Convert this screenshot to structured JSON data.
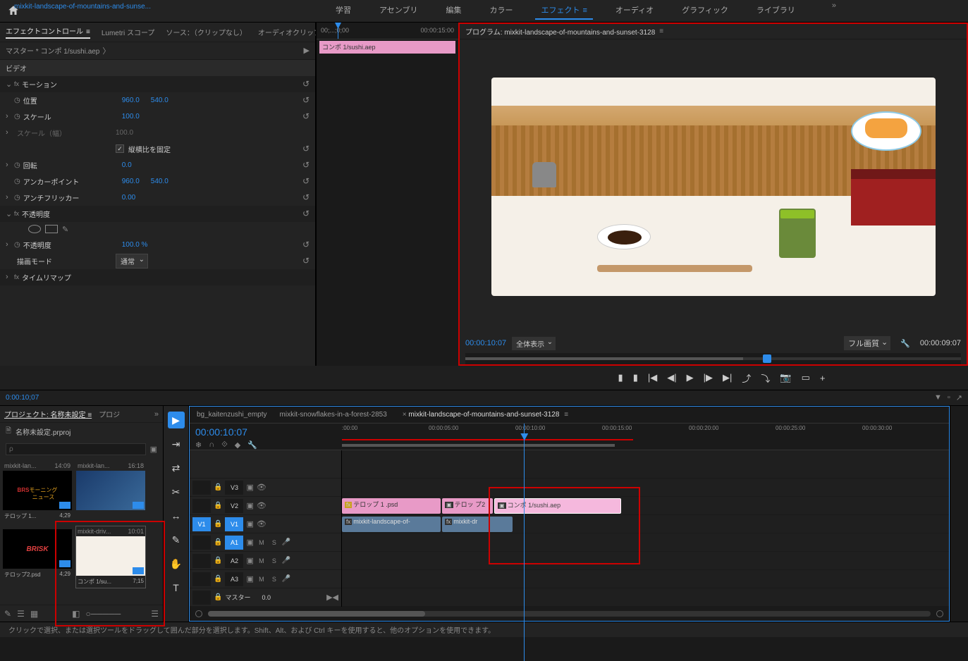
{
  "topbar": {
    "tabs": [
      "学習",
      "アセンブリ",
      "編集",
      "カラー",
      "エフェクト",
      "オーディオ",
      "グラフィック",
      "ライブラリ"
    ],
    "active_tab": "エフェクト"
  },
  "effect_panel": {
    "tabs": {
      "effect_controls": "エフェクトコントロール",
      "lumetri": "Lumetri スコープ",
      "source": "ソース：（クリップなし）",
      "audio_mixer": "オーディオクリップミキサー：mixkit"
    },
    "master": "マスター * コンポ 1/sushi.aep",
    "clip": "mixkit-landscape-of-mountains-and-sunse...",
    "video_label": "ビデオ",
    "motion": "モーション",
    "position": {
      "label": "位置",
      "x": "960.0",
      "y": "540.0"
    },
    "scale": {
      "label": "スケール",
      "value": "100.0"
    },
    "scale_w": {
      "label": "スケール（幅）",
      "value": "100.0"
    },
    "aspect_lock": "縦横比を固定",
    "rotation": {
      "label": "回転",
      "value": "0.0"
    },
    "anchor": {
      "label": "アンカーポイント",
      "x": "960.0",
      "y": "540.0"
    },
    "antiflicker": {
      "label": "アンチフリッカー",
      "value": "0.00"
    },
    "opacity_section": "不透明度",
    "opacity": {
      "label": "不透明度",
      "value": "100.0 %"
    },
    "blend_mode": {
      "label": "描画モード",
      "value": "通常"
    },
    "time_remap": "タイムリマップ"
  },
  "mini_timeline": {
    "start": "00;...;0;00",
    "end": "00:00:15:00",
    "clip": "コンポ 1/sushi.aep"
  },
  "program": {
    "title": "プログラム: mixkit-landscape-of-mountains-and-sunset-3128",
    "timecode": "00:00:10:07",
    "fit": "全体表示",
    "quality": "フル画質",
    "duration": "00:00:09:07"
  },
  "source_tc": "0:00:10;07",
  "project": {
    "tabs": {
      "project": "プロジェクト: 名称未設定",
      "more": "プロジ"
    },
    "filename": "名称未設定.prproj",
    "search_placeholder": "ρ",
    "bins": [
      {
        "name": "mixkit-lan...",
        "dur": "14:09",
        "label": "テロップ 1...",
        "sublabel": "4;29",
        "type": "brs"
      },
      {
        "name": "mixkit-lan...",
        "dur": "16:18",
        "label": "",
        "sublabel": "",
        "type": "blue"
      },
      {
        "name": "",
        "dur": "",
        "label": "テロップ2.psd",
        "sublabel": "4;29",
        "type": "brisk"
      },
      {
        "name": "mixkit-driv...",
        "dur": "10:01",
        "label": "コンポ 1/su...",
        "sublabel": "7;15",
        "type": "sushi"
      }
    ]
  },
  "timeline": {
    "tabs": [
      {
        "label": "bg_kaitenzushi_empty"
      },
      {
        "label": "mixkit-snowflakes-in-a-forest-2853"
      },
      {
        "label": "mixkit-landscape-of-mountains-and-sunset-3128",
        "active": true,
        "closable": true
      }
    ],
    "timecode": "00:00:10:07",
    "ruler": [
      ":00:00",
      "00:00:05:00",
      "00:00:10:00",
      "00:00:15:00",
      "00:00:20:00",
      "00:00:25:00",
      "00:00:30:00"
    ],
    "tracks": {
      "v3": "V3",
      "v2": "V2",
      "v1": "V1",
      "v1_src": "V1",
      "a1": "A1",
      "a2": "A2",
      "a3": "A3",
      "master": "マスター",
      "master_val": "0.0",
      "mute": "M",
      "solo": "S"
    },
    "clips": {
      "telop1": "テロップ 1 .psd",
      "telop2": "テロッ プ2",
      "sushi": "コンポ 1/sushi.aep",
      "mixkit1": "mixkit-landscape-of-",
      "mixkit2": "mixkit-dr"
    }
  },
  "status": "クリックで選択、または選択ツールをドラッグして囲んだ部分を選択します。Shift、Alt、および Ctrl キーを使用すると、他のオプションを使用できます。"
}
